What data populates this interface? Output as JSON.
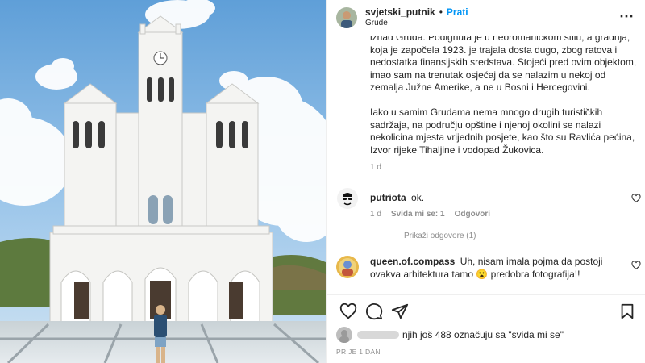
{
  "post": {
    "username": "svjetski_putnik",
    "separator": "•",
    "follow_label": "Prati",
    "location": "Grude",
    "more_icon": "more-horizontal-icon"
  },
  "caption": {
    "paragraph1": "iznad Gruda. Podignuta je u neoromaničkom stilu, a gradnja, koja je započela 1923. je trajala dosta dugo, zbog ratova i nedostatka finansijskih sredstava. Stojeći pred ovim objektom, imao sam na trenutak osjećaj da se nalazim u nekoj od zemalja Južne Amerike, a ne u Bosni i Hercegovini.",
    "paragraph2": "Iako u samim Grudama nema mnogo drugih turističkih sadržaja, na području opštine i njenoj okolini se nalazi nekolicina mjesta vrijednih posjete, kao što su Ravlića pećina, Izvor rijeke Tihaljine i vodopad Žukovica.",
    "age": "1 d"
  },
  "comments": [
    {
      "username": "putriota",
      "text": "ok.",
      "age": "1 d",
      "likes": "Sviđa mi se: 1",
      "reply_label": "Odgovori"
    },
    {
      "username": "queen.of.compass",
      "text": "Uh, nisam imala pojma da postoji ovakva arhitektura tamo 😮 predobra fotografija!!"
    }
  ],
  "replies_toggle": "Prikaži odgovore (1)",
  "likes_line": {
    "text": "njih još 488 označuju sa \"sviđa mi se\""
  },
  "time_ago": "PRIJE 1 DAN",
  "colors": {
    "accent": "#0095f6",
    "muted": "#8e8e8e",
    "text": "#262626"
  }
}
